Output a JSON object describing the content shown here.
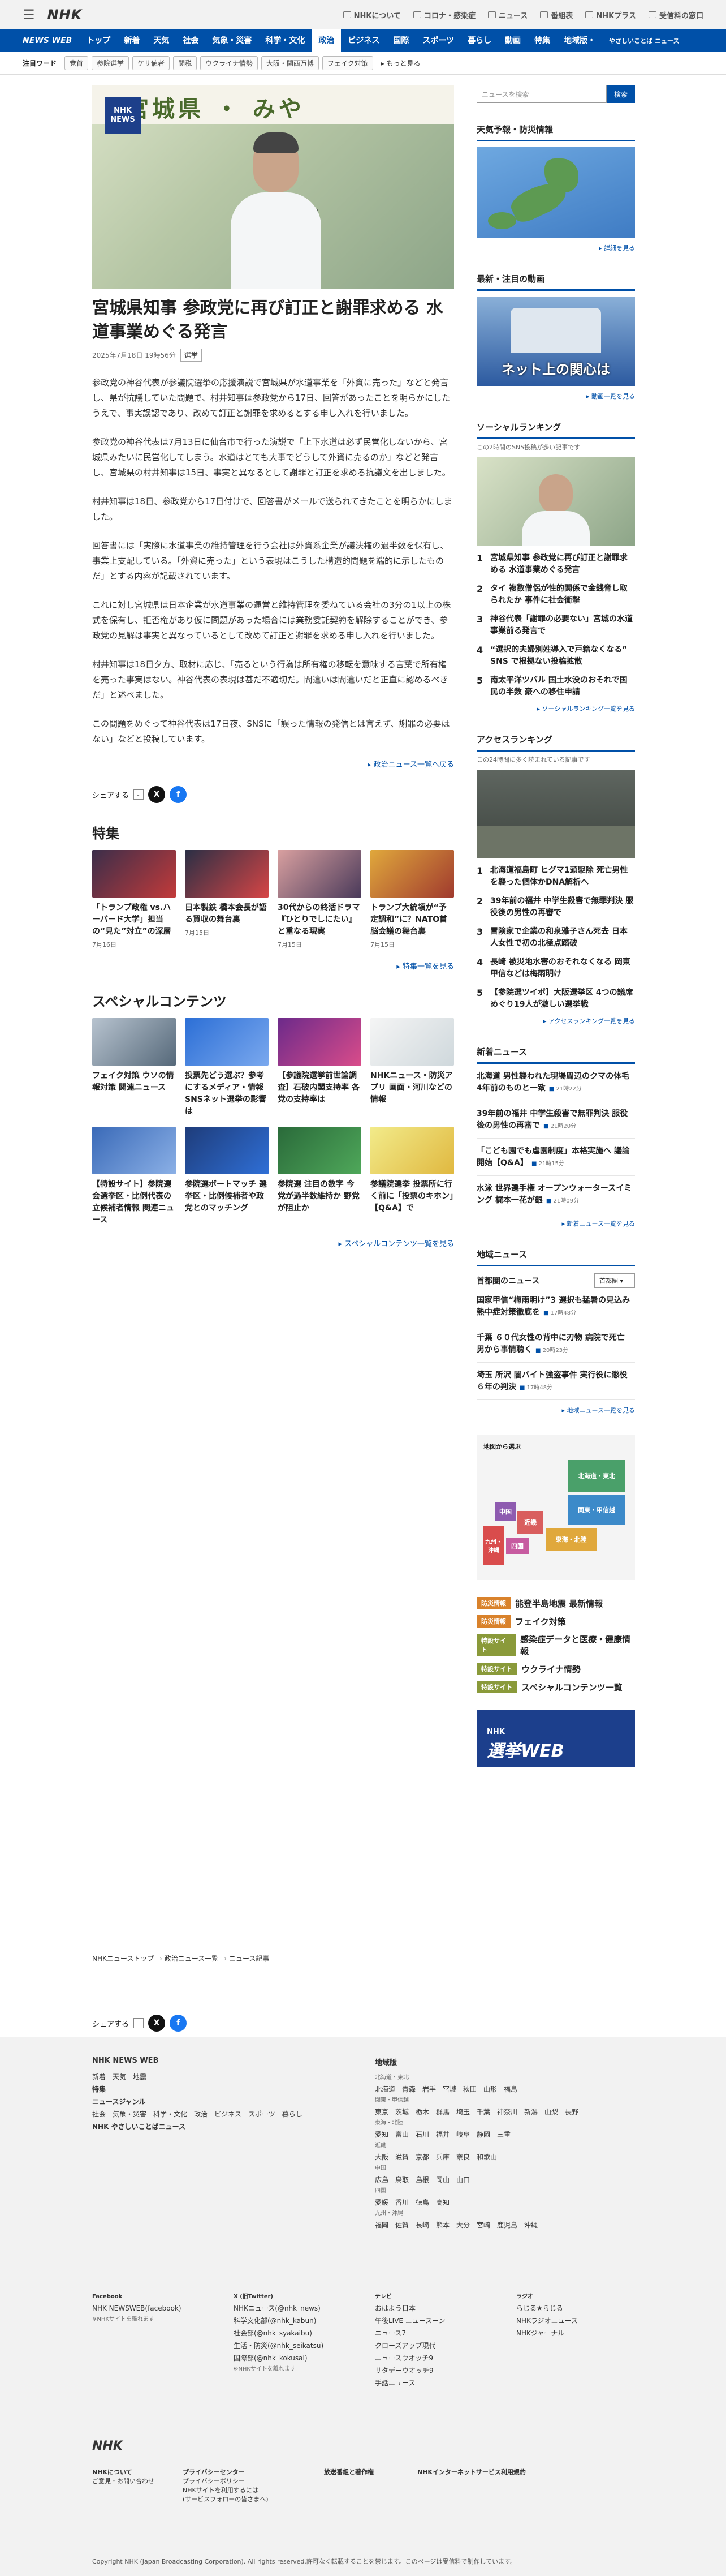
{
  "header": {
    "logo": "NHK",
    "links": [
      "NHKについて",
      "コロナ・感染症",
      "ニュース",
      "番組表",
      "NHKプラス",
      "受信料の窓口"
    ]
  },
  "nav": {
    "brand": "NEWS WEB",
    "items": [
      "トップ",
      "新着",
      "天気",
      "社会",
      "気象・災害",
      "科学・文化",
      "政治",
      "ビジネス",
      "国際",
      "スポーツ",
      "暮らし",
      "動画",
      "特集",
      "地域版・",
      "やさしいことば ニュース"
    ],
    "active": "政治"
  },
  "keywords": {
    "label": "注目ワード",
    "tags": [
      "党首",
      "参院選挙",
      "ケサ値者",
      "関税",
      "ウクライナ情勢",
      "大阪・関西万博",
      "フェイク対策"
    ],
    "more": "もっと見る"
  },
  "article": {
    "headline": "宮城県知事 参政党に再び訂正と謝罪求める 水道事業めぐる発言",
    "date": "2025年7月18日 19時56分",
    "category": "選挙",
    "paragraphs": [
      "参政党の神谷代表が参議院選挙の応援演説で宮城県が水道事業を「外資に売った」などと発言し、県が抗議していた問題で、村井知事は参政党から17日、回答があったことを明らかにしたうえで、事実誤認であり、改めて訂正と謝罪を求めるとする申し入れを行いました。",
      "参政党の神谷代表は7月13日に仙台市で行った演説で「上下水道は必ず民営化しないから、宮城県みたいに民営化してしまう。水道はとても大事でどうして外資に売るのか」などと発言し、宮城県の村井知事は15日、事実と異なるとして謝罪と訂正を求める抗議文を出しました。",
      "村井知事は18日、参政党から17日付けで、回答書がメールで送られてきたことを明らかにしました。",
      "回答書には「実際に水道事業の維持管理を行う会社は外資系企業が議決権の過半数を保有し、事業上支配している。「外資に売った」という表現はこうした構造的問題を端的に示したものだ」とする内容が記載されています。",
      "これに対し宮城県は日本企業が水道事業の運営と維持管理を委ねている会社の3分の1以上の株式を保有し、拒否権があり仮に問題があった場合には業務委託契約を解除することができ、参政党の見解は事実と異なっているとして改めて訂正と謝罪を求める申し入れを行いました。",
      "村井知事は18日夕方、取材に応じ、「売るという行為は所有権の移転を意味する言葉で所有権を売った事実はない。神谷代表の表現は甚だ不適切だ。間違いは間違いだと正直に認めるべきだ」と述べました。",
      "この問題をめぐって神谷代表は17日夜、SNSに「誤った情報の発信とは言えず、謝罪の必要はない」などと投稿しています。"
    ],
    "more": "政治ニュース一覧へ戻る"
  },
  "share_label": "シェアする",
  "features": {
    "title": "特集",
    "more": "特集一覧を見る",
    "items": [
      {
        "title": "「トランプ政権 vs.ハーバード大学」担当の“見た”対立”の深層",
        "date": "7月16日",
        "c1": "#3b2e4a",
        "c2": "#c23a3a"
      },
      {
        "title": "日本製鉄 橋本会長が語る買収の舞台裏",
        "date": "7月15日",
        "c1": "#2a2f45",
        "c2": "#d64545"
      },
      {
        "title": "30代からの終活ドラマ『ひとりでしにたい』と重なる現実",
        "date": "7月15日",
        "c1": "#d9a0a0",
        "c2": "#4a3a5a"
      },
      {
        "title": "トランプ大統領が“予定調和”に？NATO首脳会議の舞台裏",
        "date": "7月15日",
        "c1": "#e0a83c",
        "c2": "#a03a2e"
      }
    ]
  },
  "special": {
    "title": "スペシャルコンテンツ",
    "more": "スペシャルコンテンツ一覧を見る",
    "items": [
      {
        "title": "フェイク対策 ウソの情報対策 関連ニュース",
        "c1": "#b7c3cf",
        "c2": "#56697a"
      },
      {
        "title": "投票先どう選ぶ？参考にするメディア・情報 SNSネット選挙の影響は",
        "c1": "#2c6fd6",
        "c2": "#7aa8ee"
      },
      {
        "title": "【参議院選挙前世論調査】石破内閣支持率 各党の支持率は",
        "c1": "#6c2a8a",
        "c2": "#d94c8a"
      },
      {
        "title": "NHKニュース・防災アプリ 画面・河川などの情報",
        "c1": "#f5f5f5",
        "c2": "#cfd8dc"
      },
      {
        "title": "【特設サイト】参院選 会選挙区・比例代表の立候補者情報 関連ニュース",
        "c1": "#3a6ab8",
        "c2": "#8bb0e6"
      },
      {
        "title": "参院選ボートマッチ 選挙区・比例候補者や政党とのマッチング",
        "c1": "#1e3c7a",
        "c2": "#2f6fd6"
      },
      {
        "title": "参院選 注目の数字 今党が過半数維持か 野党が阻止か",
        "c1": "#2a6a3a",
        "c2": "#4fa85a"
      },
      {
        "title": "参議院選挙 投票所に行く前に「投票のキホン」【Q&A】で",
        "c1": "#f2eb8a",
        "c2": "#e0b840"
      }
    ]
  },
  "sidebar": {
    "search_placeholder": "ニュースを検索",
    "search_button": "検索",
    "weather": {
      "title": "天気予報・防災情報",
      "more": "詳細を見る"
    },
    "video": {
      "title": "最新・注目の動画",
      "caption": "ネット上の関心は",
      "more": "動画一覧を見る"
    },
    "social": {
      "title": "ソーシャルランキング",
      "sub": "この2時間のSNS投稿が多い記事です",
      "items": [
        "宮城県知事 参政党に再び訂正と謝罪求める 水道事業めぐる発言",
        "タイ 複数僧侶が性的関係で金銭脅し取られたか 事件に社会衝撃",
        "神谷代表「謝罪の必要ない」宮城の水道事業前る発言で",
        "“選択的夫婦別姓導入で戸籍なくなる” SNS で根拠ない投稿拡散",
        "南太平洋ツバル 国土水没のおそれで国民の半数 豪への移住申請"
      ],
      "more": "ソーシャルランキング一覧を見る"
    },
    "access": {
      "title": "アクセスランキング",
      "sub": "この24時間に多く読まれている記事です",
      "items": [
        "北海道福島町 ヒグマ1頭駆除 死亡男性を襲った個体かDNA解析へ",
        "39年前の福井 中学生殺害で無罪判決 服役後の男性の再審で",
        "冒険家で企業の和泉雅子さん死去 日本人女性で初の北極点踏破",
        "長崎 被災地水害のおそれなくなる 岡東甲信などは梅雨明け",
        "【参院選ツイボ】大阪選挙区 4つの議席めぐり19人が激しい選挙戦"
      ],
      "more": "アクセスランキング一覧を見る"
    },
    "new": {
      "title": "新着ニュース",
      "items": [
        {
          "t": "北海道 男性襲われた現場周辺のクマの体毛 4年前のものと一致",
          "tm": "21時22分"
        },
        {
          "t": "39年前の福井 中学生殺害で無罪判決 服役後の男性の再審で",
          "tm": "21時20分"
        },
        {
          "t": "「こども園でも虐園制度」本格実施へ 議論開始【Q&A】",
          "tm": "21時15分"
        },
        {
          "t": "水泳 世界選手権 オープンウォータースイミング 梶本一花が銀",
          "tm": "21時09分"
        }
      ],
      "more": "新着ニュース一覧を見る"
    },
    "local": {
      "title": "地域ニュース",
      "region_label": "首都圏のニュース",
      "region_select": "首都圏",
      "items": [
        {
          "t": "国家甲信“梅雨明け”3 選択も猛暑の見込み 熱中症対策徹底を",
          "tm": "17時48分"
        },
        {
          "t": "千葉 ６０代女性の背中に刃物 病院で死亡 男から事情聴く",
          "tm": "20時23分"
        },
        {
          "t": "埼玉 所沢 闇バイト強盗事件 実行役に懲役６年の判決",
          "tm": "17時48分"
        }
      ],
      "more": "地域ニュース一覧を見る"
    },
    "map": {
      "title": "地図から選ぶ",
      "regions": [
        "北海道・東北",
        "関東・甲信越",
        "東海・北陸",
        "近畿",
        "中国",
        "四国",
        "九州・沖縄"
      ]
    },
    "featured": [
      {
        "badge": "防災情報",
        "color": "#d9822b",
        "label": "能登半島地震 最新情報"
      },
      {
        "badge": "防災情報",
        "color": "#d9822b",
        "label": "フェイク対策"
      },
      {
        "badge": "特設サイト",
        "color": "#8a9a3a",
        "label": "感染症データと医療・健康情報"
      },
      {
        "badge": "特設サイト",
        "color": "#8a9a3a",
        "label": "ウクライナ情勢"
      },
      {
        "badge": "特設サイト",
        "color": "#8a9a3a",
        "label": "スペシャルコンテンツ一覧"
      }
    ],
    "senkyo": {
      "small": "NHK",
      "big": "選挙WEB"
    }
  },
  "breadcrumb": [
    "NHKニューストップ",
    "政治ニュース一覧",
    "ニュース記事"
  ],
  "footer": {
    "col1_title": "NHK NEWS WEB",
    "col1_links": [
      "新着　天気　地震",
      "特集",
      "ニュースジャンル",
      "社会　気象・災害　科学・文化　政治　ビジネス　スポーツ　暮らし",
      "NHK やさしいことばニュース"
    ],
    "col2_title": "地域版",
    "col2_links": [
      "北海道・東北",
      "北海道　青森　岩手　宮城　秋田　山形　福島",
      "関東・甲信越",
      "東京　茨城　栃木　群馬　埼玉　千葉　神奈川　新潟　山梨　長野",
      "東海・北陸",
      "愛知　富山　石川　福井　岐阜　静岡　三重",
      "近畿",
      "大阪　滋賀　京都　兵庫　奈良　和歌山",
      "中国",
      "広島　鳥取　島根　岡山　山口",
      "四国",
      "愛媛　香川　徳島　高知",
      "九州・沖縄",
      "福岡　佐賀　長崎　熊本　大分　宮崎　鹿児島　沖縄"
    ],
    "sns": [
      {
        "h": "Facebook",
        "l": [
          "NHK NEWSWEB(facebook)",
          "※NHKサイトを離れます"
        ]
      },
      {
        "h": "X (旧Twitter)",
        "l": [
          "NHKニュース(@nhk_news)",
          "科学文化部(@nhk_kabun)",
          "社会部(@nhk_syakaibu)",
          "生活・防災(@nhk_seikatsu)",
          "国際部(@nhk_kokusai)",
          "※NHKサイトを離れます"
        ]
      },
      {
        "h": "テレビ",
        "l": [
          "おはよう日本",
          "午後LIVE ニュースーン",
          "ニュース7",
          "クローズアップ現代",
          "ニュースウオッチ9",
          "サタデーウオッチ9",
          "手話ニュース"
        ]
      },
      {
        "h": "ラジオ",
        "l": [
          "らじる★らじる",
          "NHKラジオニュース",
          "NHKジャーナル"
        ]
      }
    ],
    "bottom_logo": "NHK",
    "bottom_links": [
      [
        "NHKについて",
        "ご意見・お問い合わせ"
      ],
      [
        "プライバシーセンター",
        "プライバシーポリシー",
        "NHKサイトを利用するには",
        "(サービスフォローの皆さまへ)"
      ],
      [
        "放送番組と著作権"
      ],
      [
        "NHKインターネットサービス利用規約"
      ]
    ],
    "copyright": "Copyright NHK (Japan Broadcasting Corporation). All rights reserved.許可なく転載することを禁じます。このページは受信料で制作しています。"
  }
}
